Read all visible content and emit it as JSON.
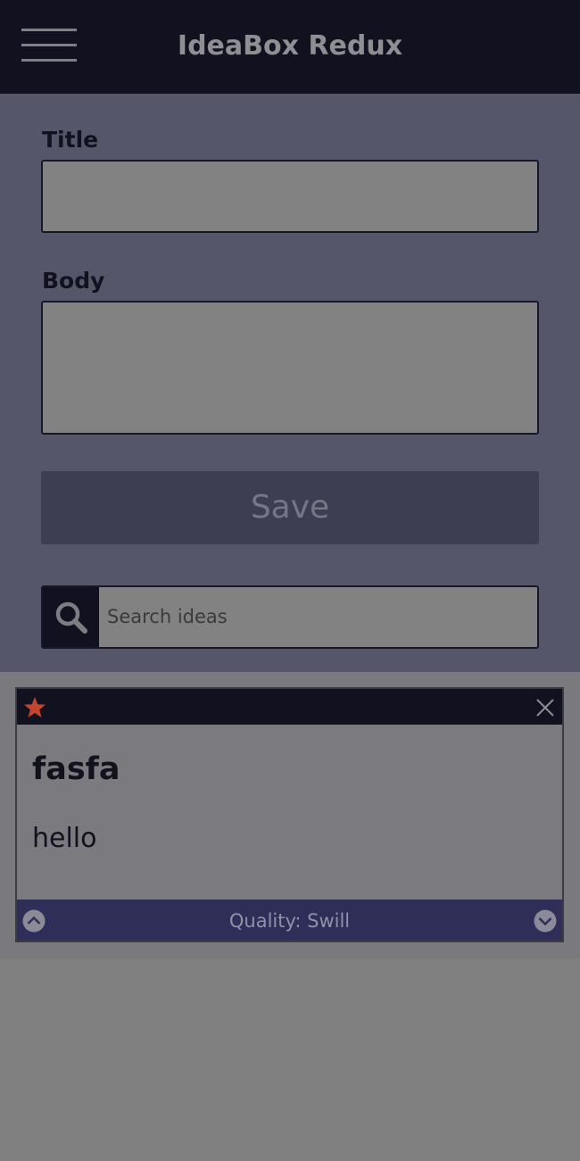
{
  "header": {
    "title": "IdeaBox Redux"
  },
  "form": {
    "title_label": "Title",
    "title_value": "",
    "body_label": "Body",
    "body_value": "",
    "save_label": "Save"
  },
  "search": {
    "placeholder": "Search ideas",
    "value": ""
  },
  "ideas": [
    {
      "title": "fasfa",
      "body": "hello",
      "quality_text": "Quality: Swill",
      "starred": true
    }
  ],
  "colors": {
    "header_bg": "#11111f",
    "form_bg": "#56566b",
    "save_bg": "#3e3e52",
    "footer_bg": "#2e2e58",
    "star": "#c2452e"
  },
  "icons": [
    "menu-icon",
    "search-icon",
    "star-icon",
    "close-icon",
    "chevron-up-icon",
    "chevron-down-icon"
  ]
}
